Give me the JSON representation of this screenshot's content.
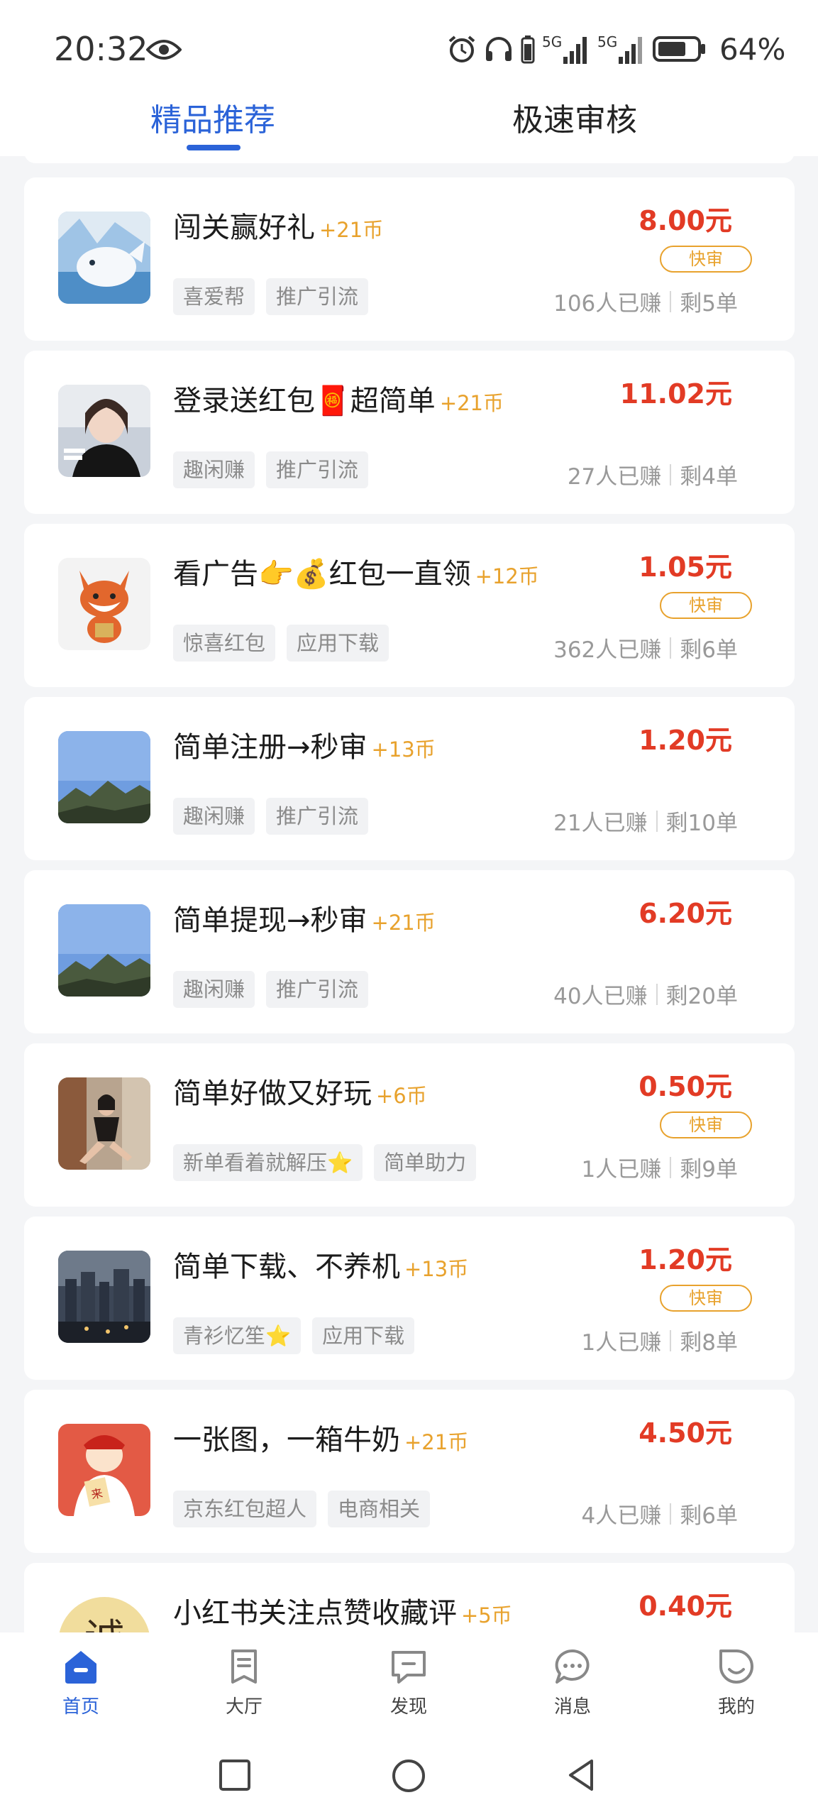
{
  "status_bar": {
    "time": "20:32",
    "battery": "64%",
    "icons": [
      "eye-icon",
      "alarm-icon",
      "headphones-icon",
      "battery-small-icon",
      "signal-5g-icon",
      "signal-5g-icon",
      "battery-icon"
    ]
  },
  "tabs": [
    {
      "label": "精品推荐",
      "active": true
    },
    {
      "label": "极速审核",
      "active": false
    }
  ],
  "colors": {
    "accent": "#2b63d8",
    "price": "#e23b25",
    "coins": "#e8a22d",
    "background": "#f4f5f7"
  },
  "tasks": [
    {
      "title": "闯关赢好礼",
      "coins": "+21币",
      "price": "8.00元",
      "fast": "快审",
      "tags": [
        "喜爱帮",
        "推广引流"
      ],
      "earned": "106人已赚",
      "remaining": "剩5单",
      "thumb": "whale-image"
    },
    {
      "title": "登录送红包🧧超简单",
      "coins": "+21币",
      "price": "11.02元",
      "fast": "",
      "tags": [
        "趣闲赚",
        "推广引流"
      ],
      "earned": "27人已赚",
      "remaining": "剩4单",
      "thumb": "girl-photo"
    },
    {
      "title": "看广告👉💰红包一直领",
      "coins": "+12币",
      "price": "1.05元",
      "fast": "快审",
      "tags": [
        "惊喜红包",
        "应用下载"
      ],
      "earned": "362人已赚",
      "remaining": "剩6单",
      "thumb": "fox-cartoon"
    },
    {
      "title": "简单注册→秒审",
      "coins": "+13币",
      "price": "1.20元",
      "fast": "",
      "tags": [
        "趣闲赚",
        "推广引流"
      ],
      "earned": "21人已赚",
      "remaining": "剩10单",
      "thumb": "landscape-photo"
    },
    {
      "title": "简单提现→秒审",
      "coins": "+21币",
      "price": "6.20元",
      "fast": "",
      "tags": [
        "趣闲赚",
        "推广引流"
      ],
      "earned": "40人已赚",
      "remaining": "剩20单",
      "thumb": "landscape-photo"
    },
    {
      "title": "简单好做又好玩",
      "coins": "+6币",
      "price": "0.50元",
      "fast": "快审",
      "tags": [
        "新单看着就解压⭐",
        "简单助力"
      ],
      "earned": "1人已赚",
      "remaining": "剩9单",
      "thumb": "woman-photo"
    },
    {
      "title": "简单下载、不养机",
      "coins": "+13币",
      "price": "1.20元",
      "fast": "快审",
      "tags": [
        "青衫忆笙⭐",
        "应用下载"
      ],
      "earned": "1人已赚",
      "remaining": "剩8单",
      "thumb": "city-night-photo"
    },
    {
      "title": "一张图，一箱牛奶",
      "coins": "+21币",
      "price": "4.50元",
      "fast": "",
      "tags": [
        "京东红包超人",
        "电商相关"
      ],
      "earned": "4人已赚",
      "remaining": "剩6单",
      "thumb": "fortune-god-cartoon"
    },
    {
      "title": "小红书关注点赞收藏评",
      "coins": "+5币",
      "price": "0.40元",
      "fast": "",
      "tags": [],
      "earned": "",
      "remaining": "",
      "thumb": "cheng-char-image",
      "thumb_text": "诚"
    }
  ],
  "bottom_nav": [
    {
      "label": "首页",
      "icon": "home-icon",
      "active": true
    },
    {
      "label": "大厅",
      "icon": "hall-icon",
      "active": false
    },
    {
      "label": "发现",
      "icon": "discover-icon",
      "active": false
    },
    {
      "label": "消息",
      "icon": "message-icon",
      "active": false
    },
    {
      "label": "我的",
      "icon": "profile-icon",
      "active": false
    }
  ],
  "system_nav": [
    "recent-apps-icon",
    "home-circle-icon",
    "back-icon"
  ]
}
